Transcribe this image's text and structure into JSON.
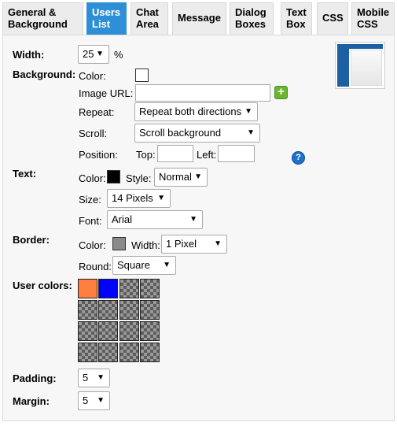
{
  "tabs": [
    {
      "line1": "General &",
      "line2": "Background"
    },
    {
      "line1": "Users",
      "line2": "List"
    },
    {
      "line1": "Chat",
      "line2": "Area"
    },
    {
      "line1": "Message",
      "line2": ""
    },
    {
      "line1": "Dialog",
      "line2": "Boxes"
    },
    {
      "line1": "Text",
      "line2": "Box"
    },
    {
      "line1": "CSS",
      "line2": ""
    },
    {
      "line1": "Mobile",
      "line2": "CSS"
    }
  ],
  "active_tab": "Users List",
  "width": {
    "label": "Width:",
    "value": "25",
    "unit": "%"
  },
  "background": {
    "label": "Background:",
    "color_label": "Color:",
    "color": "#ffffff",
    "image_url_label": "Image URL:",
    "image_url_value": "",
    "repeat_label": "Repeat:",
    "repeat_value": "Repeat both directions",
    "scroll_label": "Scroll:",
    "scroll_value": "Scroll background",
    "position_label": "Position:",
    "top_label": "Top:",
    "top_value": "",
    "left_label": "Left:",
    "left_value": ""
  },
  "text": {
    "label": "Text:",
    "color_label": "Color:",
    "color": "#000000",
    "style_label": "Style:",
    "style_value": "Normal",
    "size_label": "Size:",
    "size_value": "14 Pixels",
    "font_label": "Font:",
    "font_value": "Arial"
  },
  "border": {
    "label": "Border:",
    "color_label": "Color:",
    "color": "#8a8a8a",
    "width_label": "Width:",
    "width_value": "1 Pixel",
    "round_label": "Round:",
    "round_value": "Square"
  },
  "user_colors": {
    "label": "User colors:",
    "colors": [
      "#ff7f3f",
      "#0000ff"
    ]
  },
  "padding": {
    "label": "Padding:",
    "value": "5"
  },
  "margin": {
    "label": "Margin:",
    "value": "5"
  },
  "icons": {
    "add": "plus-icon",
    "help": "help-icon",
    "dropdown": "chevron-down-icon"
  }
}
